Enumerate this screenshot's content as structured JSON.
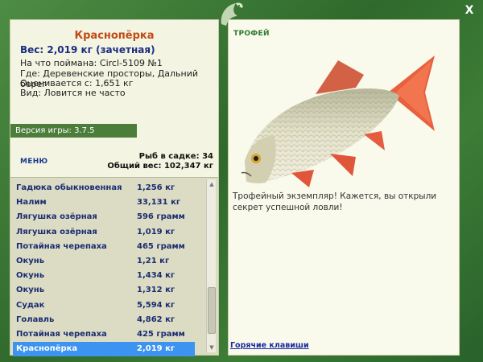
{
  "window": {
    "close_label": "X"
  },
  "fish": {
    "name": "Краснопёрка",
    "weight_line": "Вес: 2,019 кг (зачетная)",
    "caught_on": "На что поймана: Circl-5109 №1",
    "location": "Где: Деревенские просторы, Дальний берег",
    "value": "Оценивается с: 1,651 кг",
    "rarity": "Вид: Ловится не часто"
  },
  "version": "Версия игры: 3.7.5",
  "menu_label": "МЕНЮ",
  "stats": {
    "fish_count": "Рыб в садке: 34",
    "total_weight": "Общий вес: 102,347 кг"
  },
  "catch_list": [
    {
      "name": "Гадюка обыкновенная",
      "weight": "1,256 кг"
    },
    {
      "name": "Налим",
      "weight": "33,131 кг"
    },
    {
      "name": "Лягушка озёрная",
      "weight": "596 грамм"
    },
    {
      "name": "Лягушка озёрная",
      "weight": "1,019 кг"
    },
    {
      "name": "Потайная черепаха",
      "weight": "465 грамм"
    },
    {
      "name": "Окунь",
      "weight": "1,21 кг"
    },
    {
      "name": "Окунь",
      "weight": "1,434 кг"
    },
    {
      "name": "Окунь",
      "weight": "1,312 кг"
    },
    {
      "name": "Судак",
      "weight": "5,594 кг"
    },
    {
      "name": "Голавль",
      "weight": "4,862 кг"
    },
    {
      "name": "Потайная черепаха",
      "weight": "425 грамм"
    },
    {
      "name": "Краснопёрка",
      "weight": "2,019 кг",
      "selected": true
    }
  ],
  "trophy": {
    "title": "ТРОФЕЙ",
    "text": "Трофейный экземпляр! Кажется, вы открыли секрет успешной ловли!"
  },
  "hotkeys_label": "Горячие клавиши",
  "icons": {
    "close": "close-icon",
    "emblem": "fish-emblem-icon",
    "scroll_up": "scroll-up-icon",
    "scroll_down": "scroll-down-icon"
  },
  "colors": {
    "frame": "#3f7a3a",
    "fish_name": "#c04a17",
    "list_text": "#1a2c70",
    "selection": "#3d93f0",
    "trophy_title": "#2d7a2d"
  }
}
